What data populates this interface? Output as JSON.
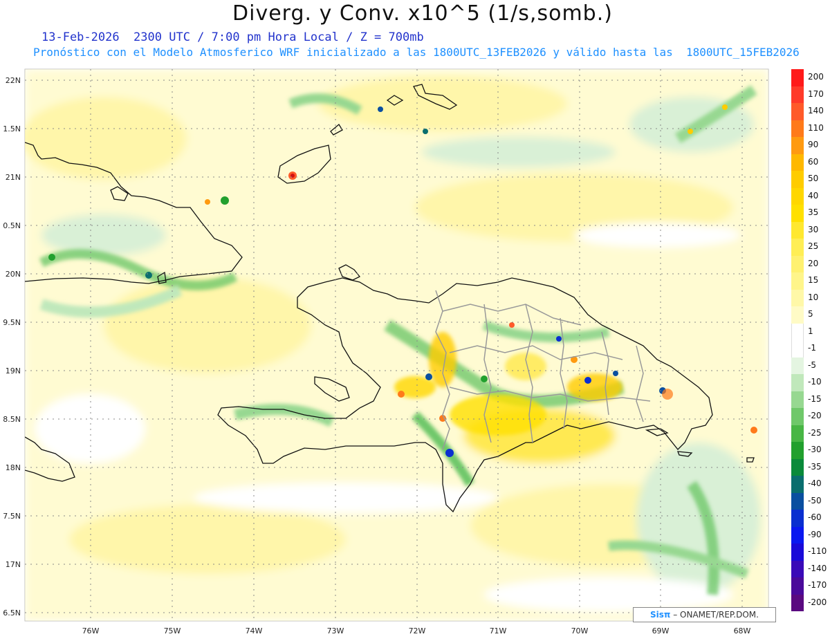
{
  "header": {
    "title": "Diverg. y Conv. x10^5 (1/s,somb.)",
    "subtitle_time": "13-Feb-2026  2300 UTC / 7:00 pm Hora Local / Z = 700mb",
    "subtitle_model": "Pronóstico con el Modelo Atmosferico WRF inicializado a las 1800UTC_13FEB2026 y válido hasta las  1800UTC_15FEB2026"
  },
  "axes": {
    "lat_labels": [
      "22N",
      "1.5N",
      "21N",
      "0.5N",
      "20N",
      "9.5N",
      "19N",
      "8.5N",
      "18N",
      "7.5N",
      "17N",
      "6.5N"
    ],
    "lon_labels": [
      "76W",
      "75W",
      "74W",
      "73W",
      "72W",
      "71W",
      "70W",
      "69W",
      "68W"
    ]
  },
  "legend": {
    "labels": [
      "200",
      "170",
      "140",
      "110",
      "90",
      "60",
      "50",
      "40",
      "35",
      "30",
      "25",
      "20",
      "15",
      "10",
      "5",
      "1",
      "-1",
      "-5",
      "-10",
      "-15",
      "-20",
      "-25",
      "-30",
      "-35",
      "-40",
      "-50",
      "-60",
      "-90",
      "-110",
      "-140",
      "-170",
      "-200"
    ],
    "colors": [
      "#ff1a1a",
      "#ff3a2a",
      "#ff5a2a",
      "#ff7a1a",
      "#ff9a10",
      "#ffb800",
      "#ffcc00",
      "#ffd700",
      "#ffe000",
      "#ffe830",
      "#ffee55",
      "#fff170",
      "#fff58a",
      "#fff8a8",
      "#fffbc6",
      "#ffffff",
      "#ffffff",
      "#e4f5e1",
      "#c0e8bb",
      "#97d891",
      "#6fc86a",
      "#48b645",
      "#22a02e",
      "#0a8a3a",
      "#0a6e6e",
      "#0a4fa0",
      "#0a2fd0",
      "#0a18f0",
      "#1a0ad8",
      "#3a0ab8",
      "#4a0a9a",
      "#5a0a80"
    ]
  },
  "credit": {
    "brand": "Sisπ",
    "text": " – ONAMET/REP.DOM."
  },
  "map_features": {
    "region": "Hispaniola, eastern Cuba, Bahamas",
    "islands": [
      "Hispaniola",
      "Cuba",
      "Great Inagua",
      "Gonâve",
      "Île à Vache",
      "Saona"
    ]
  }
}
